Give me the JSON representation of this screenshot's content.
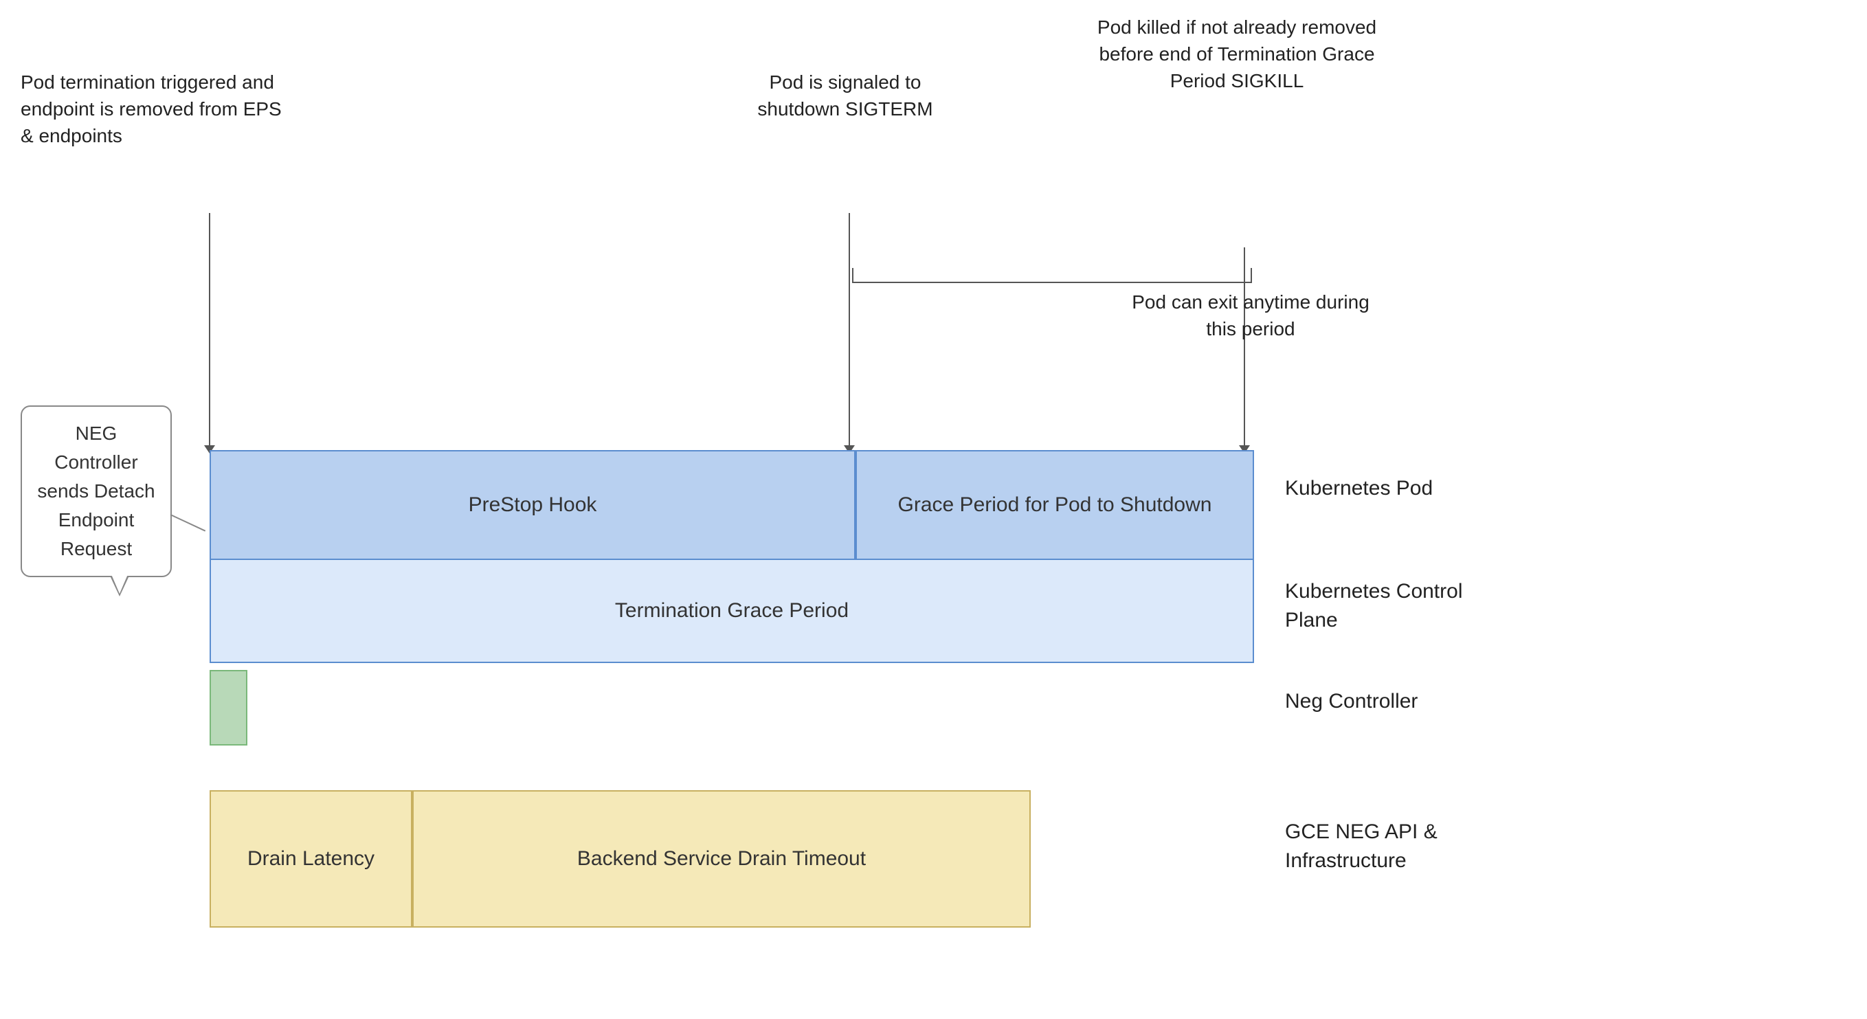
{
  "annotations": {
    "pod_termination": "Pod termination triggered\nand endpoint is removed\nfrom EPS & endpoints",
    "pod_signaled": "Pod is signaled to\nshutdown\nSIGTERM",
    "pod_killed": "Pod killed if not\nalready removed\nbefore end of\nTermination Grace\nPeriod\nSIGKILL",
    "pod_can_exit": "Pod can exit anytime\nduring this period",
    "grace_period_for_pod": "Grace Period for\nPod to Shutdown",
    "prestop_hook": "PreStop Hook",
    "termination_grace_period": "Termination Grace Period",
    "drain_latency": "Drain\nLatency",
    "backend_service_drain": "Backend Service Drain Timeout",
    "neg_callout": "NEG\nController\nsends\nDetach\nEndpoint\nRequest",
    "termination_grace_label": "Termination Grace",
    "kubernetes_pod": "Kubernetes Pod",
    "kubernetes_control_plane": "Kubernetes\nControl Plane",
    "neg_controller": "Neg Controller",
    "gce_neg_api": "GCE NEG API &\nInfrastructure"
  }
}
